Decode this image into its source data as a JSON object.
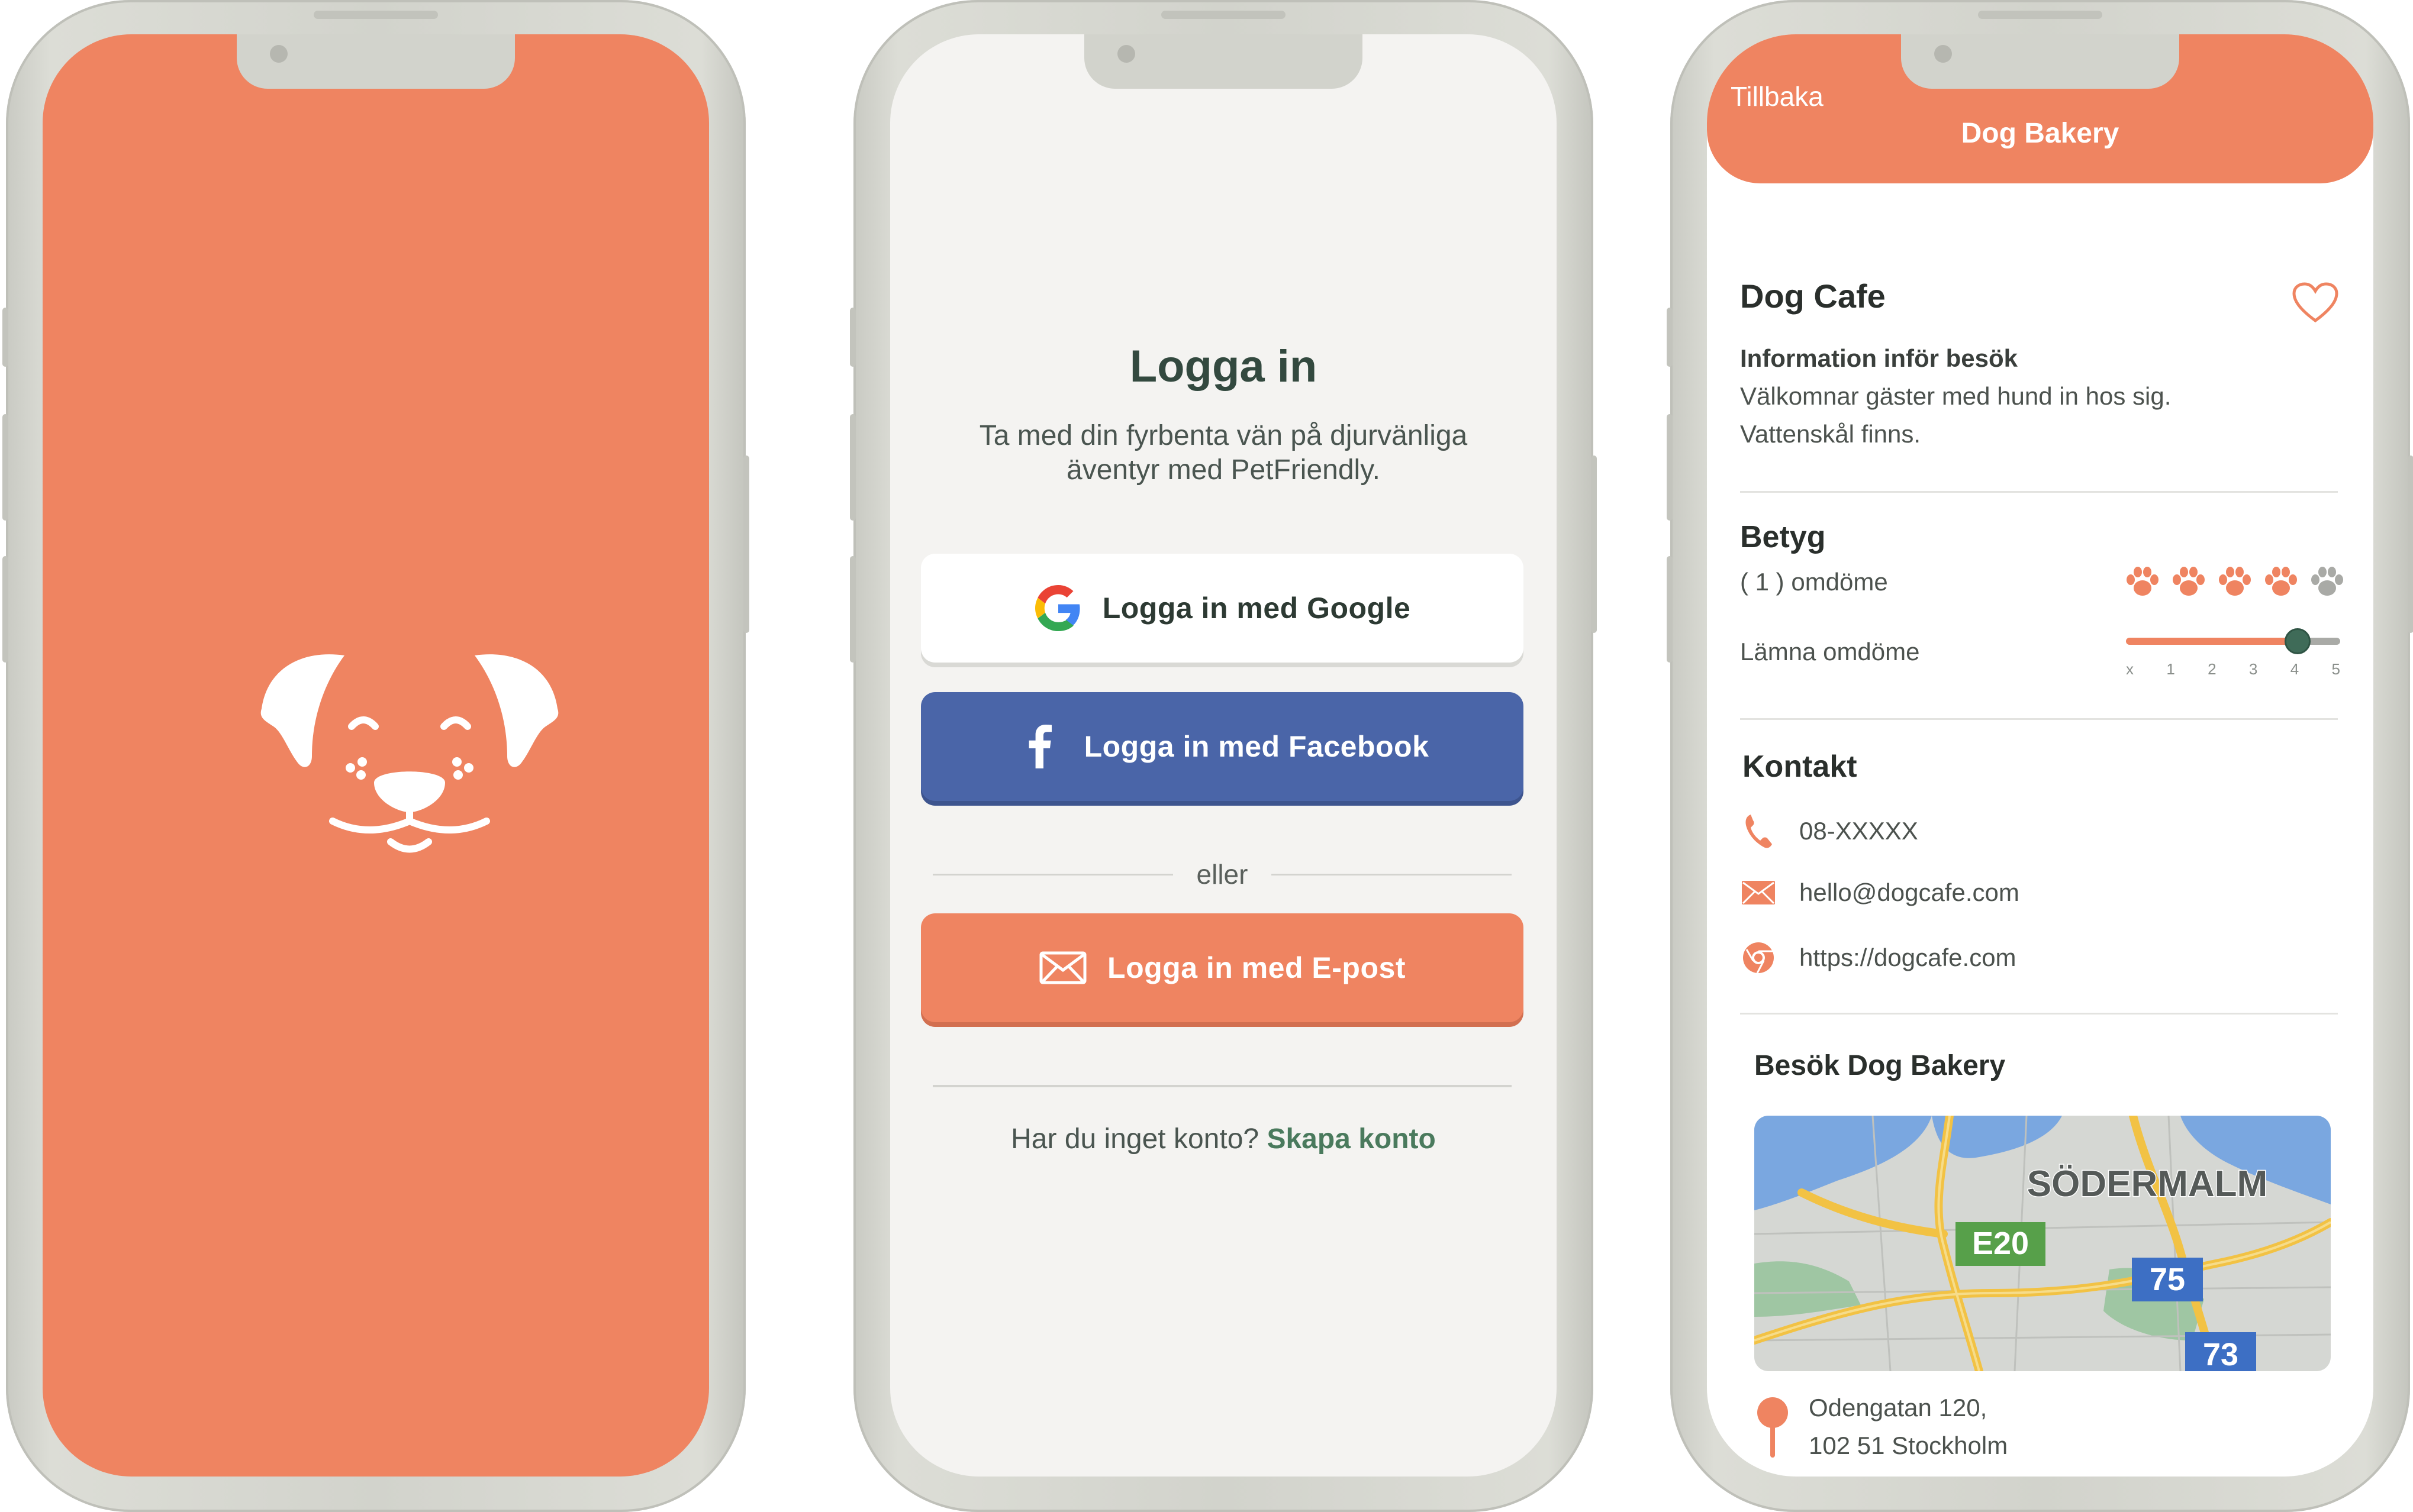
{
  "login": {
    "title": "Logga in",
    "subtitle": "Ta med din fyrbenta vän på djurvänliga äventyr med PetFriendly.",
    "google_label": "Logga in med Google",
    "facebook_label": "Logga in med Facebook",
    "divider_text": "eller",
    "email_label": "Logga in med E-post",
    "no_account_text": "Har du inget konto?",
    "create_account_label": "Skapa konto"
  },
  "detail": {
    "back_label": "Tillbaka",
    "header_title": "Dog Bakery",
    "place_name": "Dog Cafe",
    "info_heading": "Information inför besök",
    "info_line1": "Välkomnar gäster med hund in hos sig.",
    "info_line2": "Vattenskål finns.",
    "rating_heading": "Betyg",
    "reviews_count": "( 1 ) omdöme",
    "rating_value": 4,
    "rating_max": 5,
    "leave_review_label": "Lämna omdöme",
    "slider_value": 4,
    "slider_ticks": [
      "x",
      "1",
      "2",
      "3",
      "4",
      "5"
    ],
    "contact_heading": "Kontakt",
    "phone": "08-XXXXX",
    "email": "hello@dogcafe.com",
    "website": "https://dogcafe.com",
    "visit_heading": "Besök Dog Bakery",
    "map_labels": {
      "district": "SÖDERMALM",
      "road_e20": "E20",
      "road_75": "75",
      "road_73": "73"
    },
    "address_line1": "Odengatan 120,",
    "address_line2": "102 51 Stockholm"
  },
  "colors": {
    "brand_orange": "#ef8461",
    "facebook_blue": "#4a65a8",
    "accent_green": "#4a7a5d",
    "paw_inactive": "#a9aaa6"
  }
}
